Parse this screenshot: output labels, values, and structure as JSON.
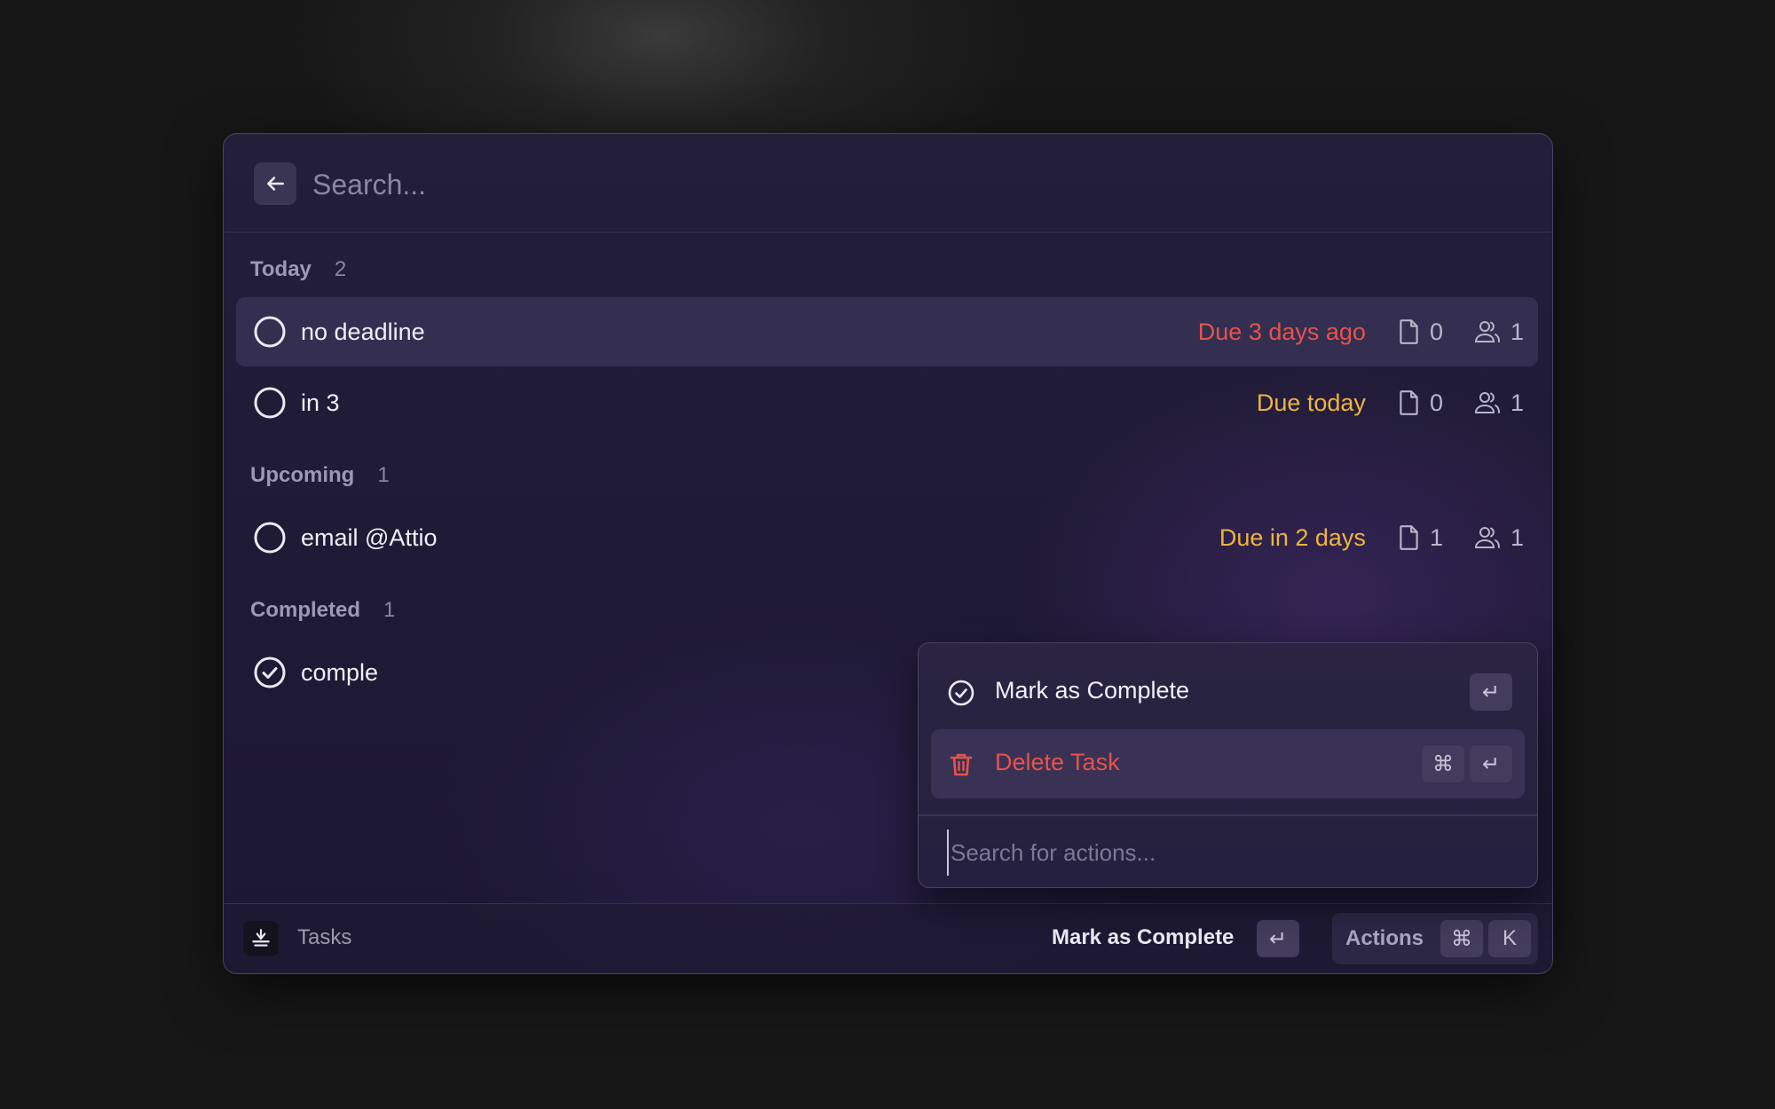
{
  "search": {
    "placeholder": "Search..."
  },
  "sections": [
    {
      "label": "Today",
      "count": "2"
    },
    {
      "label": "Upcoming",
      "count": "1"
    },
    {
      "label": "Completed",
      "count": "1"
    }
  ],
  "tasks": [
    {
      "title": "no deadline",
      "due": "Due 3 days ago",
      "files": "0",
      "members": "1",
      "status": "open"
    },
    {
      "title": "in 3",
      "due": "Due today",
      "files": "0",
      "members": "1",
      "status": "open"
    },
    {
      "title": "email @Attio",
      "due": "Due in 2 days",
      "files": "1",
      "members": "1",
      "status": "open"
    },
    {
      "title": "comple",
      "status": "completed"
    }
  ],
  "colors": {
    "overdue": "#e5534b",
    "due_soon": "#f0b43c",
    "accent_bg": "#1c1733"
  },
  "action_menu": {
    "items": [
      {
        "label": "Mark as Complete",
        "icon": "check-circle-icon",
        "keys": [
          "↵"
        ]
      },
      {
        "label": "Delete Task",
        "icon": "trash-icon",
        "keys": [
          "⌘",
          "↵"
        ]
      }
    ],
    "search_placeholder": "Search for actions..."
  },
  "footer": {
    "app_label": "Tasks",
    "primary_action": "Mark as Complete",
    "primary_key": "↵",
    "actions_label": "Actions",
    "actions_keys": [
      "⌘",
      "K"
    ]
  }
}
